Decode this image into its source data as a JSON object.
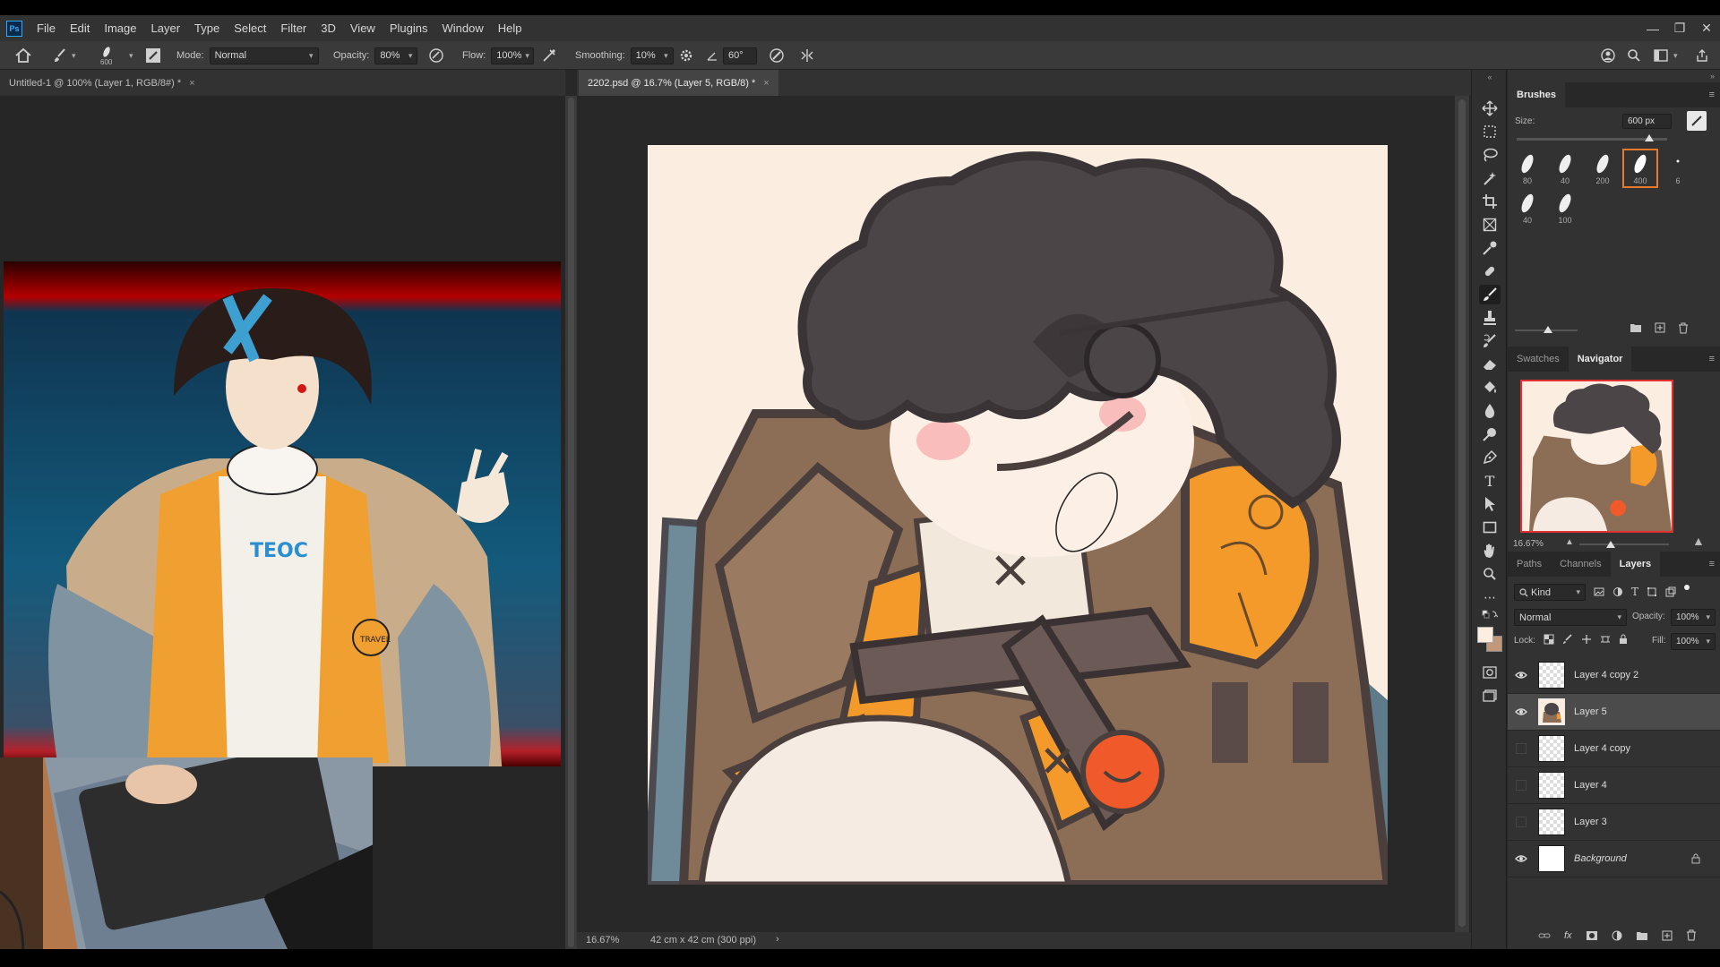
{
  "app": {
    "logo": "Ps"
  },
  "menu": [
    "File",
    "Edit",
    "Image",
    "Layer",
    "Type",
    "Select",
    "Filter",
    "3D",
    "View",
    "Plugins",
    "Window",
    "Help"
  ],
  "options": {
    "brush_size": "600",
    "mode_label": "Mode:",
    "mode_value": "Normal",
    "opacity_label": "Opacity:",
    "opacity_value": "80%",
    "flow_label": "Flow:",
    "flow_value": "100%",
    "smoothing_label": "Smoothing:",
    "smoothing_value": "10%",
    "angle_value": "60°"
  },
  "documents": [
    {
      "title": "Untitled-1 @ 100% (Layer 1, RGB/8#) *",
      "close": "×"
    },
    {
      "title": "2202.psd @ 16.7% (Layer 5, RGB/8) *",
      "close": "×"
    }
  ],
  "canvas_status": {
    "zoom": "16.67%",
    "doc_size": "42 cm x 42 cm (300 ppi)",
    "arrow": "›"
  },
  "brushes": {
    "title": "Brushes",
    "size_label": "Size:",
    "size_value": "600 px",
    "size_slider_level": 0.88,
    "tips": [
      "80",
      "40",
      "200",
      "400",
      "6",
      "40",
      "100"
    ],
    "selected_tip": "400"
  },
  "navigator": {
    "tabs": [
      "Swatches",
      "Navigator"
    ],
    "active": "Navigator",
    "zoom": "16.67%",
    "zoom_slider_level": 0.35
  },
  "layers_panel": {
    "tabs": [
      "Paths",
      "Channels",
      "Layers"
    ],
    "active": "Layers",
    "filter_value": "Kind",
    "blend_mode": "Normal",
    "opacity_label": "Opacity:",
    "opacity_value": "100%",
    "lock_label": "Lock:",
    "fill_label": "Fill:",
    "fill_value": "100%",
    "layers": [
      {
        "name": "Layer 4 copy 2",
        "visible": true
      },
      {
        "name": "Layer 5",
        "visible": true,
        "selected": true
      },
      {
        "name": "Layer 4 copy",
        "visible": false
      },
      {
        "name": "Layer 4",
        "visible": false
      },
      {
        "name": "Layer 3",
        "visible": false
      },
      {
        "name": "Background",
        "visible": true,
        "locked": true
      }
    ]
  },
  "colors": {
    "accent": "#31a8ff",
    "selection": "#e8782b",
    "canvas_bg": "#fbeee0"
  }
}
